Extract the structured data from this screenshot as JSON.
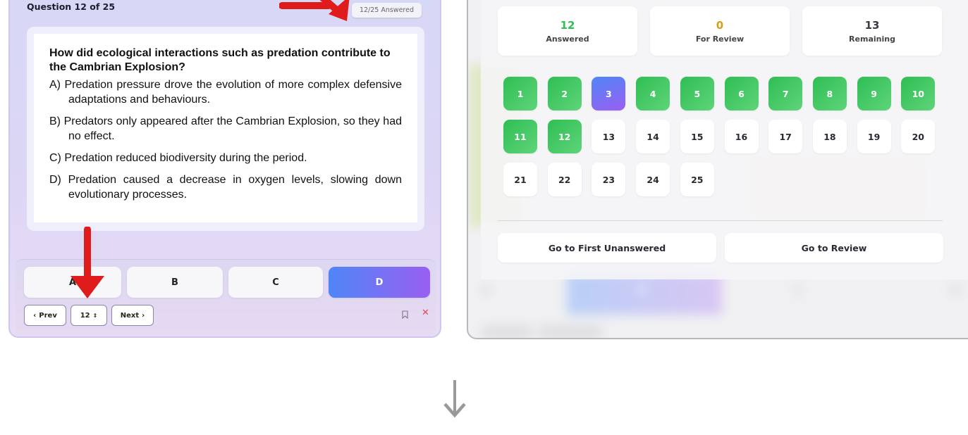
{
  "left": {
    "header": "Question 12 of 25",
    "badge": "12/25 Answered",
    "question": "How did ecological interactions such as predation contribute to the Cambrian Explosion?",
    "options": [
      "A) Predation pressure drove the evolution of more complex defensive adaptations and behaviours.",
      "B) Predators only appeared after the Cambrian Explosion, so they had no effect.",
      "C) Predation reduced biodiversity during the period.",
      "D) Predation caused a decrease in oxygen levels, slowing down evolutionary processes."
    ],
    "answers": [
      "A",
      "B",
      "C",
      "D"
    ],
    "selected_answer": "D",
    "nav": {
      "prev": "Prev",
      "current": "12",
      "next": "Next"
    },
    "icons": {
      "prev": "chevron-left-icon",
      "select": "up-down-chevron-icon",
      "next": "chevron-right-icon",
      "bookmark": "bookmark-icon",
      "close": "close-icon"
    }
  },
  "right": {
    "stats": {
      "answered_value": "12",
      "answered_label": "Answered",
      "review_value": "0",
      "review_label": "For Review",
      "remaining_value": "13",
      "remaining_label": "Remaining"
    },
    "questions": [
      "1",
      "2",
      "3",
      "4",
      "5",
      "6",
      "7",
      "8",
      "9",
      "10",
      "11",
      "12",
      "13",
      "14",
      "15",
      "16",
      "17",
      "18",
      "19",
      "20",
      "21",
      "22",
      "23",
      "24",
      "25"
    ],
    "answered_numbers": [
      1,
      2,
      4,
      5,
      6,
      7,
      8,
      9,
      10,
      11,
      12
    ],
    "current_number": 3,
    "go_first_unanswered": "Go to First Unanswered",
    "go_review": "Go to Review",
    "background_letters": [
      "A",
      "B",
      "C",
      "D"
    ]
  },
  "colors": {
    "green": "#2fbe53",
    "orange": "#d4a017",
    "accent_blue": "#4f86f7",
    "accent_purple": "#9a5ff2",
    "arrow_red": "#e01b1b",
    "close_red": "#e24a4a"
  }
}
